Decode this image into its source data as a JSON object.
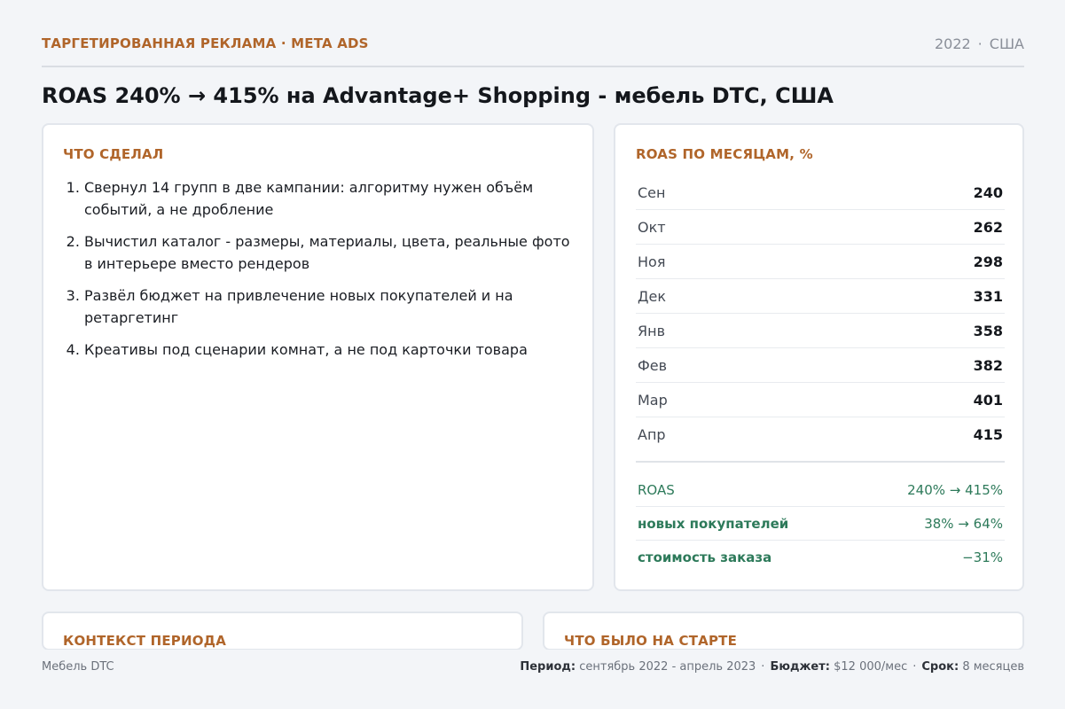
{
  "header": {
    "eyebrow": "ТАРГЕТИРОВАННАЯ РЕКЛАМА · META ADS",
    "year": "2022",
    "separator": "·",
    "country": "США"
  },
  "title": "ROAS 240% → 415% на Advantage+ Shopping - мебель DTC, США",
  "done": {
    "heading": "ЧТО СДЕЛАЛ",
    "items": [
      "Свернул 14 групп в две кампании: алгоритму нужен объём событий, а не дробление",
      "Вычистил каталог - размеры, материалы, цвета, реальные фото в интерьере вместо рендеров",
      "Развёл бюджет на привлечение новых покупателей и на ретаргетинг",
      "Креативы под сценарии комнат, а не под карточки товара"
    ]
  },
  "roas": {
    "heading": "ROAS ПО МЕСЯЦАМ, %",
    "months": [
      {
        "label": "Сен",
        "value": "240"
      },
      {
        "label": "Окт",
        "value": "262"
      },
      {
        "label": "Ноя",
        "value": "298"
      },
      {
        "label": "Дек",
        "value": "331"
      },
      {
        "label": "Янв",
        "value": "358"
      },
      {
        "label": "Фев",
        "value": "382"
      },
      {
        "label": "Мар",
        "value": "401"
      },
      {
        "label": "Апр",
        "value": "415"
      }
    ],
    "summary": [
      {
        "label": "ROAS",
        "value": "240% → 415%"
      },
      {
        "label": "новых покупателей",
        "value": "38% → 64%"
      },
      {
        "label": "стоимость заказа",
        "value": "−31%"
      }
    ]
  },
  "context": {
    "heading": "КОНТЕКСТ ПЕРИОДА"
  },
  "start": {
    "heading": "ЧТО БЫЛО НА СТАРТЕ"
  },
  "footer": {
    "client": "Мебель DTC",
    "period_label": "Период:",
    "period_value": "сентябрь 2022 - апрель 2023",
    "budget_label": "Бюджет:",
    "budget_value": "$12 000/мес",
    "term_label": "Срок:",
    "term_value": "8 месяцев",
    "separator": "·"
  },
  "colors": {
    "accent": "#b0652a",
    "positive": "#2d7a5a",
    "background": "#f3f5f8"
  }
}
